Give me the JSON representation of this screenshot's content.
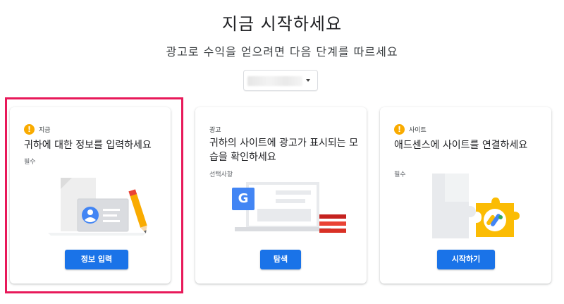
{
  "header": {
    "title": "지금 시작하세요",
    "subtitle": "광고로 수익을 얻으려면 다음 단계를 따르세요"
  },
  "site_selector": {
    "value": ""
  },
  "cards": [
    {
      "tag": "지금",
      "title": "귀하에 대한 정보를 입력하세요",
      "requirement": "필수",
      "button": "정보 입력"
    },
    {
      "tag": "광고",
      "title": "귀하의 사이트에 광고가 표시되는 모습을 확인하세요",
      "requirement": "선택사항",
      "button": "탐색",
      "illustration_letter": "G"
    },
    {
      "tag": "사이트",
      "title": "애드센스에 사이트를 연결하세요",
      "requirement": "필수",
      "button": "시작하기"
    }
  ],
  "colors": {
    "accent": "#1a73e8",
    "warning": "#f9ab00",
    "highlight": "#e8195a",
    "adsense_yellow": "#fbbc04"
  }
}
